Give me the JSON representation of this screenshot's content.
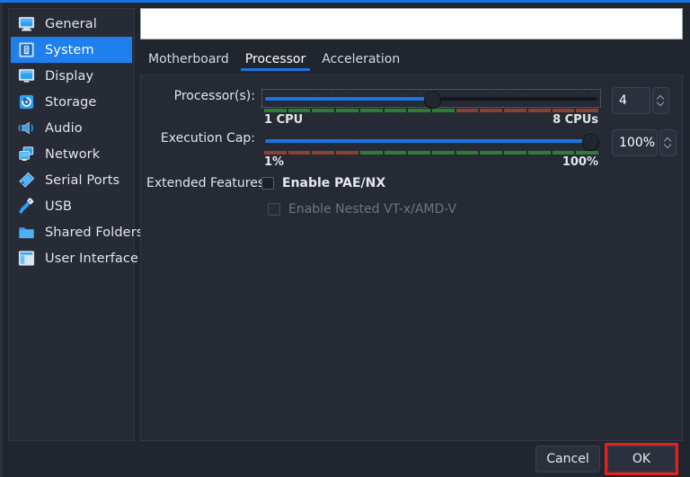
{
  "window": {
    "accent_color": "#1a74e2",
    "background": "#21252e"
  },
  "sidebar": {
    "items": [
      {
        "label": "General",
        "icon": "monitor-icon",
        "selected": false
      },
      {
        "label": "System",
        "icon": "cpu-chip-icon",
        "selected": true
      },
      {
        "label": "Display",
        "icon": "display-icon",
        "selected": false
      },
      {
        "label": "Storage",
        "icon": "storage-disk-icon",
        "selected": false
      },
      {
        "label": "Audio",
        "icon": "speaker-icon",
        "selected": false
      },
      {
        "label": "Network",
        "icon": "network-icon",
        "selected": false
      },
      {
        "label": "Serial Ports",
        "icon": "serial-port-icon",
        "selected": false
      },
      {
        "label": "USB",
        "icon": "usb-icon",
        "selected": false
      },
      {
        "label": "Shared Folders",
        "icon": "folder-icon",
        "selected": false
      },
      {
        "label": "User Interface",
        "icon": "user-interface-icon",
        "selected": false
      }
    ],
    "selected_color": "#1e7fed"
  },
  "name_field": {
    "value": "",
    "placeholder": ""
  },
  "tabs": [
    {
      "label": "Motherboard",
      "active": false
    },
    {
      "label": "Processor",
      "active": true
    },
    {
      "label": "Acceleration",
      "active": false
    }
  ],
  "processor": {
    "label": "Processor(s):",
    "min_label": "1 CPU",
    "max_label": "8 CPUs",
    "value": "4",
    "percent": 50,
    "good_fraction": 55,
    "good_color": "#2f7d32",
    "warn_color": "#8c4033"
  },
  "execution_cap": {
    "label": "Execution Cap:",
    "min_label": "1%",
    "max_label": "100%",
    "value": "100%",
    "percent": 100,
    "warn_fraction": 30,
    "good_color": "#2f7d32",
    "warn_color": "#8c4033"
  },
  "extended_features": {
    "label": "Extended Features:",
    "options": [
      {
        "label": "Enable PAE/NX",
        "checked": false,
        "disabled": false
      },
      {
        "label": "Enable Nested VT-x/AMD-V",
        "checked": false,
        "disabled": true
      }
    ]
  },
  "footer": {
    "cancel_label": "Cancel",
    "ok_label": "OK",
    "highlight_color": "#e81f1f",
    "highlighted_button": "OK"
  }
}
